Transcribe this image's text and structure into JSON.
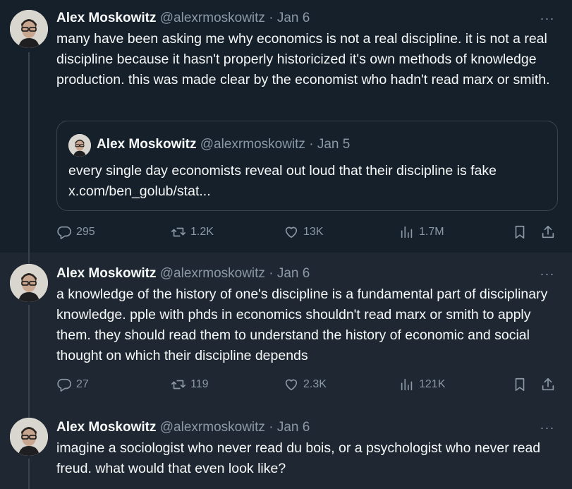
{
  "tweets": [
    {
      "author_name": "Alex Moskowitz",
      "handle": "@alexrmoskowitz",
      "date": "Jan 6",
      "more_label": "···",
      "text": "many have been asking me why economics is not a real discipline. it is not a real discipline because it hasn't properly historicized it's own methods of knowledge production. this was made clear by the economist who hadn't read marx or smith.",
      "quote": {
        "author_name": "Alex Moskowitz",
        "handle": "@alexrmoskowitz",
        "date": "Jan 5",
        "text": "every single day economists reveal out loud that their discipline is fake",
        "link": "x.com/ben_golub/stat..."
      },
      "stats": {
        "replies": "295",
        "reposts": "1.2K",
        "likes": "13K",
        "views": "1.7M"
      }
    },
    {
      "author_name": "Alex Moskowitz",
      "handle": "@alexrmoskowitz",
      "date": "Jan 6",
      "more_label": "···",
      "text": "a knowledge of the history of one's discipline is a fundamental part of disciplinary knowledge. pple with phds in economics shouldn't read marx or smith to apply them. they should read them to understand the history of economic and social thought on which their discipline depends",
      "stats": {
        "replies": "27",
        "reposts": "119",
        "likes": "2.3K",
        "views": "121K"
      }
    },
    {
      "author_name": "Alex Moskowitz",
      "handle": "@alexrmoskowitz",
      "date": "Jan 6",
      "more_label": "···",
      "text": "imagine a sociologist who never read du bois, or a psychologist who never read freud. what would that even look like?"
    }
  ],
  "separator": " · ",
  "colors": {
    "background": "#15202b",
    "background_alt": "#1e2732",
    "text_primary": "#f7f9f9",
    "text_secondary": "#8b98a5",
    "border": "#38444d"
  },
  "icons": {
    "reply": "reply-icon",
    "repost": "repost-icon",
    "like": "heart-icon",
    "views": "views-icon",
    "bookmark": "bookmark-icon",
    "share": "share-icon",
    "more": "more-icon"
  }
}
